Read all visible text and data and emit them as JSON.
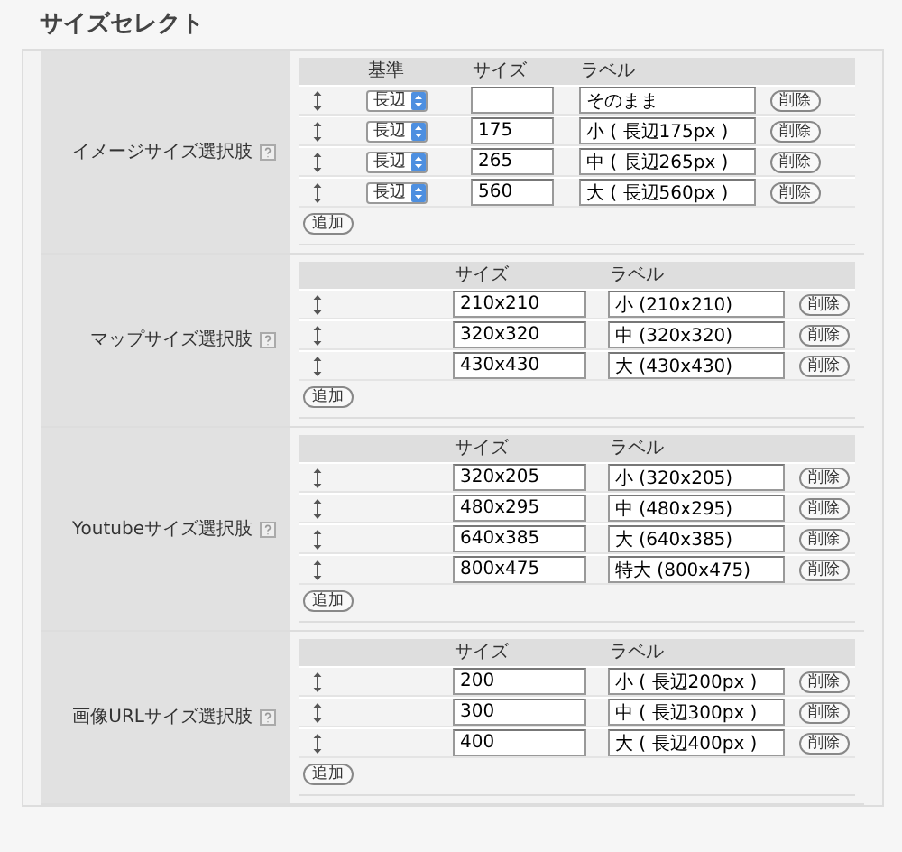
{
  "title": "サイズセレクト",
  "sections": [
    {
      "label": "イメージサイズ選択肢",
      "columns": [
        "基準",
        "サイズ",
        "ラベル"
      ],
      "rows": [
        {
          "basis": "長辺",
          "label": "そのまま",
          "delete": "削除"
        },
        {
          "basis": "長辺",
          "size": "175",
          "label": "小 ( 長辺175px )",
          "delete": "削除"
        },
        {
          "basis": "長辺",
          "size": "265",
          "label": "中 ( 長辺265px )",
          "delete": "削除"
        },
        {
          "basis": "長辺",
          "size": "560",
          "label": "大 ( 長辺560px )",
          "delete": "削除"
        }
      ],
      "add": "追加"
    },
    {
      "label": "マップサイズ選択肢",
      "columns": [
        "サイズ",
        "ラベル"
      ],
      "rows": [
        {
          "size": "210x210",
          "label": "小 (210x210)",
          "delete": "削除"
        },
        {
          "size": "320x320",
          "label": "中 (320x320)",
          "delete": "削除"
        },
        {
          "size": "430x430",
          "label": "大 (430x430)",
          "delete": "削除"
        }
      ],
      "add": "追加"
    },
    {
      "label": "Youtubeサイズ選択肢",
      "columns": [
        "サイズ",
        "ラベル"
      ],
      "rows": [
        {
          "size": "320x205",
          "label": "小 (320x205)",
          "delete": "削除"
        },
        {
          "size": "480x295",
          "label": "中 (480x295)",
          "delete": "削除"
        },
        {
          "size": "640x385",
          "label": "大 (640x385)",
          "delete": "削除"
        },
        {
          "size": "800x475",
          "label": "特大 (800x475)",
          "delete": "削除"
        }
      ],
      "add": "追加"
    },
    {
      "label": "画像URLサイズ選択肢",
      "columns": [
        "サイズ",
        "ラベル"
      ],
      "rows": [
        {
          "size": "200",
          "label": "小 ( 長辺200px )",
          "delete": "削除"
        },
        {
          "size": "300",
          "label": "中 ( 長辺300px )",
          "delete": "削除"
        },
        {
          "size": "400",
          "label": "大 ( 長辺400px )",
          "delete": "削除"
        }
      ],
      "add": "追加"
    }
  ]
}
